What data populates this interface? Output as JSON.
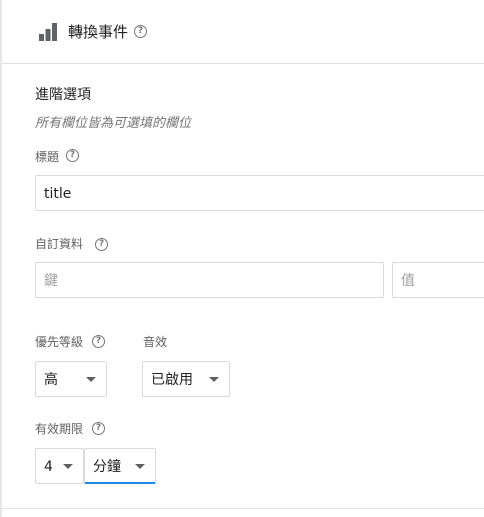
{
  "header": {
    "icon": "bar-chart-icon",
    "title": "轉換事件",
    "help": "?"
  },
  "section": {
    "title": "進階選項",
    "subtitle": "所有欄位皆為可選填的欄位"
  },
  "fields": {
    "title": {
      "label": "標題",
      "value": "title"
    },
    "custom_data": {
      "label": "自訂資料",
      "key_placeholder": "鍵",
      "value_placeholder": "值"
    },
    "priority": {
      "label": "優先等級",
      "selected": "高"
    },
    "sound": {
      "label": "音效",
      "selected": "已啟用"
    },
    "expiration": {
      "label": "有效期限",
      "number": "4",
      "unit": "分鐘"
    }
  },
  "colors": {
    "focus_underline": "#1e88e5",
    "icon": "#5f6368"
  }
}
